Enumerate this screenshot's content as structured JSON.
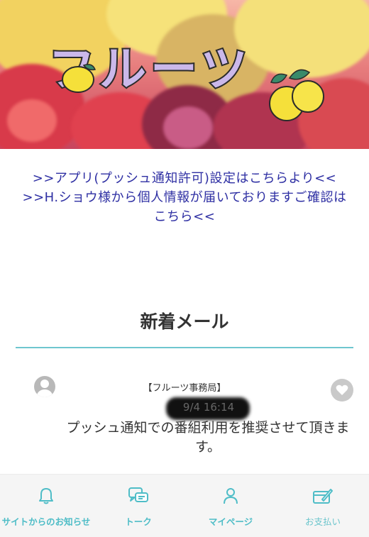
{
  "banner": {
    "title": "フルーツ"
  },
  "links": [
    ">>アプリ(プッシュ通知許可)設定はこちらより<<",
    ">>H.ショウ様から個人情報が届いておりますご確認は",
    "こちら<<"
  ],
  "section": {
    "title": "新着メール"
  },
  "mail": {
    "sender": "【フルーツ事務局】",
    "date": "9/4  16:14",
    "body": "プッシュ通知での番組利用を推奨させて頂きます。"
  },
  "nav": {
    "items": [
      {
        "label": "サイトからのお知らせ",
        "icon": "bell-icon"
      },
      {
        "label": "トーク",
        "icon": "chat-bubbles-icon"
      },
      {
        "label": "マイページ",
        "icon": "person-icon"
      },
      {
        "label": "お支払い",
        "icon": "payment-icon"
      }
    ]
  },
  "colors": {
    "accent": "#4fbdc7",
    "link": "#2e2fa3",
    "divider": "#6ec6cf"
  }
}
